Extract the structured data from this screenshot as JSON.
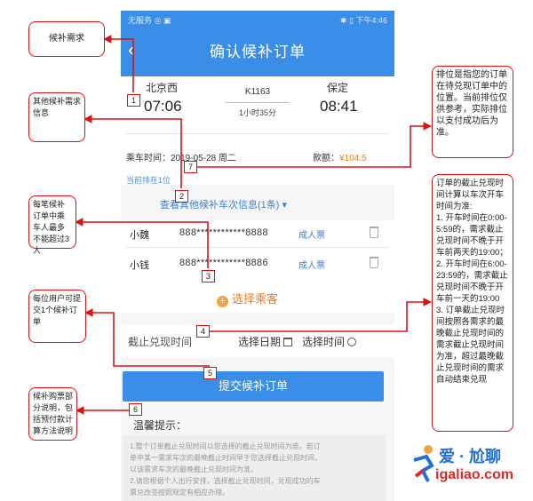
{
  "status_bar": {
    "left": "无服务 ◎ ▣",
    "right": "✱ ▯ 下午4:46"
  },
  "nav": {
    "back": "‹",
    "title": "确认候补订单"
  },
  "trip": {
    "from_station": "北京西",
    "from_time": "07:06",
    "train_no": "K1163",
    "duration": "1小时35分",
    "to_station": "保定",
    "to_time": "08:41",
    "ride_date": "乘车时间：2019-05-28 周二",
    "deposit_label": "款额：",
    "deposit_value": "¥104.5",
    "queue": "当前排在1位",
    "other_trains": "查看其他候补车次信息(1条) ▾"
  },
  "passengers": [
    {
      "name": "小魏",
      "id": "888************8888",
      "type": "成人票"
    },
    {
      "name": "小钱",
      "id": "888************8886",
      "type": "成人票"
    }
  ],
  "add_passenger": "选择乘客",
  "deadline": {
    "label": "截止兑现时间",
    "date": "选择日期",
    "time": "选择时间"
  },
  "submit": "提交候补订单",
  "tips": {
    "title": "温馨提示：",
    "lines": [
      "1.整个订单截止兑现时间以您选择的截止兑现时间为准。若订",
      "单中某一需求车次的最晚截止时间早于您选择截止兑现时间，",
      "以该需求车次的最晚截止兑现时间为准。",
      "2.请您根据个人出行安排，选择截止兑现时间，兑现成功的车",
      "票兑改签按照规定有相应办理。"
    ]
  },
  "annotations": {
    "c1": "候补需求",
    "c2": "其他候补需求信息",
    "c3": "每笔候补订单中乘车人最多不能超过3人",
    "c4": "每位用户可提交1个候补订单",
    "c5": "候补购票部分说明，包括预付款计算方法说明",
    "c6": "排位是指您的订单在待兑现订单中的位置。当前排位仅供参考，实际排位以支付成功后为准。",
    "c7": "订单的截止兑现时间计算以车次开车时间为准:\n1. 开车时间在0:00-5:59的，需求截止兑现时间不晚于开车前两天的19:00；\n2. 开车时间在6:00-23:59的，需求截止兑现时间不晚于开车前一天的19:00\n3. 订单截止兑现时间按照各需求的最晚截止兑现时间的需求截止兑现时间为准，超过最晚截止兑现时间的需求自动结束兑现",
    "n1": "1",
    "n2": "2",
    "n3": "3",
    "n4": "4",
    "n5": "5",
    "n6": "6",
    "n7": "7"
  },
  "watermark": {
    "top": "爱 · 尬聊",
    "bottom": "igaliao.com"
  },
  "colors": {
    "accent": "#3a8ee8",
    "annotation": "#dd1111",
    "price": "#f07a1c"
  }
}
